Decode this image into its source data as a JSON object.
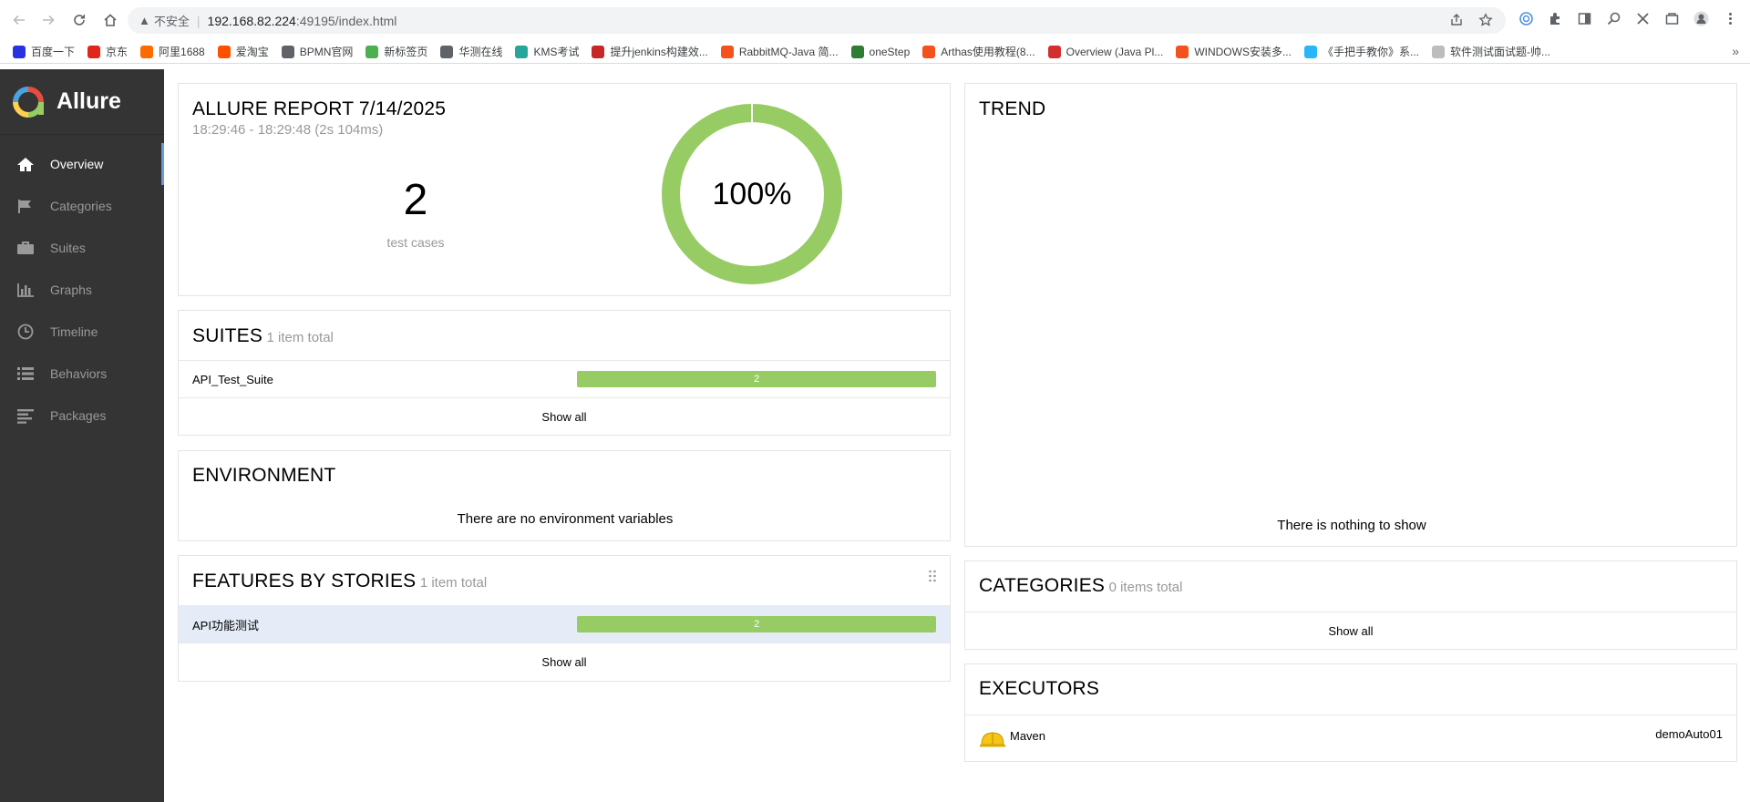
{
  "browser": {
    "security_label": "不安全",
    "url_host": "192.168.82.224",
    "url_path": ":49195/index.html",
    "bookmarks": [
      {
        "label": "百度一下",
        "color": "#2932e1"
      },
      {
        "label": "京东",
        "color": "#e1251b"
      },
      {
        "label": "阿里1688",
        "color": "#ff6a00"
      },
      {
        "label": "爱淘宝",
        "color": "#ff5000"
      },
      {
        "label": "BPMN官网",
        "color": "#5f6368"
      },
      {
        "label": "新标签页",
        "color": "#4caf50"
      },
      {
        "label": "华测在线",
        "color": "#5f6368"
      },
      {
        "label": "KMS考试",
        "color": "#26a69a"
      },
      {
        "label": "提升jenkins构建效...",
        "color": "#c62828"
      },
      {
        "label": "RabbitMQ-Java 简...",
        "color": "#f4511e"
      },
      {
        "label": "oneStep",
        "color": "#2e7d32"
      },
      {
        "label": "Arthas使用教程(8...",
        "color": "#f4511e"
      },
      {
        "label": "Overview (Java Pl...",
        "color": "#d32f2f"
      },
      {
        "label": "WINDOWS安装多...",
        "color": "#f4511e"
      },
      {
        "label": "《手把手教你》系...",
        "color": "#29b6f6"
      },
      {
        "label": "软件测试面试题-帅...",
        "color": "#bdbdbd"
      }
    ]
  },
  "sidebar": {
    "brand": "Allure",
    "items": [
      {
        "label": "Overview",
        "icon": "home-icon",
        "active": true
      },
      {
        "label": "Categories",
        "icon": "flag-icon",
        "active": false
      },
      {
        "label": "Suites",
        "icon": "briefcase-icon",
        "active": false
      },
      {
        "label": "Graphs",
        "icon": "bar-chart-icon",
        "active": false
      },
      {
        "label": "Timeline",
        "icon": "clock-icon",
        "active": false
      },
      {
        "label": "Behaviors",
        "icon": "list-icon",
        "active": false
      },
      {
        "label": "Packages",
        "icon": "align-left-icon",
        "active": false
      }
    ]
  },
  "summary": {
    "title": "ALLURE REPORT 7/14/2025",
    "time_range": "18:29:46 - 18:29:48 (2s 104ms)",
    "test_count": "2",
    "test_count_label": "test cases",
    "pass_percent_label": "100%",
    "pass_fraction": 1.0,
    "pass_color": "#97cc64"
  },
  "suites": {
    "title": "SUITES",
    "subtitle": "1 item total",
    "rows": [
      {
        "name": "API_Test_Suite",
        "count": "2"
      }
    ],
    "show_all": "Show all"
  },
  "environment": {
    "title": "ENVIRONMENT",
    "message": "There are no environment variables"
  },
  "features": {
    "title": "FEATURES BY STORIES",
    "subtitle": "1 item total",
    "rows": [
      {
        "name": "API功能测试",
        "count": "2"
      }
    ],
    "show_all": "Show all"
  },
  "trend": {
    "title": "TREND",
    "message": "There is nothing to show"
  },
  "categories": {
    "title": "CATEGORIES",
    "subtitle": "0 items total",
    "show_all": "Show all"
  },
  "executors": {
    "title": "EXECUTORS",
    "rows": [
      {
        "name": "Maven",
        "build": "demoAuto01",
        "icon": "helmet-icon"
      }
    ]
  }
}
